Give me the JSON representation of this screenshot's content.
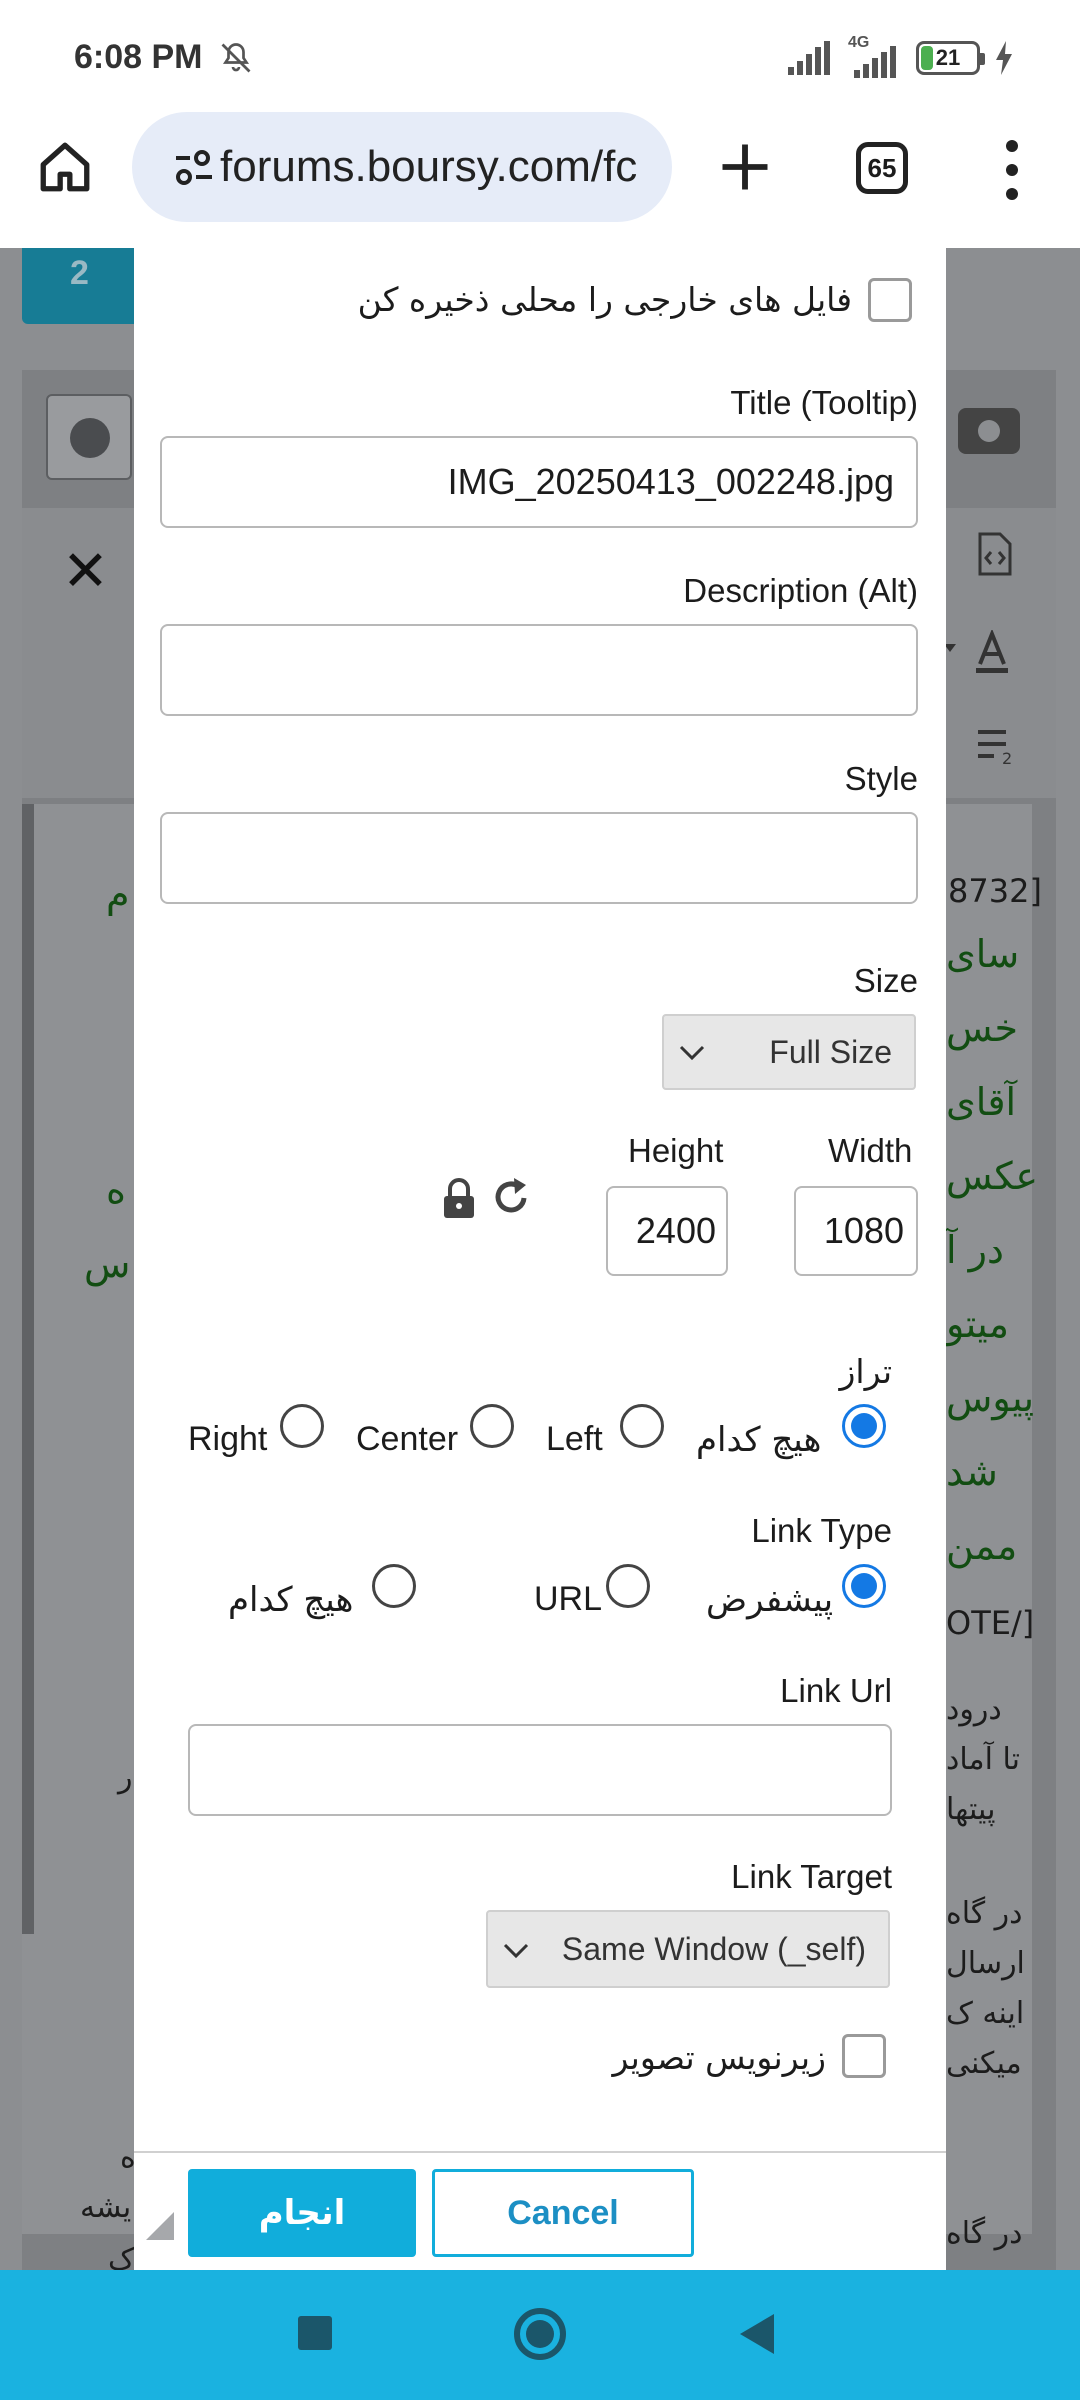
{
  "status_bar": {
    "time": "6:08 PM",
    "network": "4G",
    "battery": "21",
    "battery_level_percent": 21,
    "icons": [
      "bell-off-icon",
      "signal-icon",
      "signal-4g-icon",
      "battery-icon",
      "charging-icon"
    ]
  },
  "browser": {
    "url": "forums.boursy.com/fc",
    "tab_count": "65",
    "icons": [
      "home-icon",
      "site-settings-icon",
      "plus-icon",
      "tabs-icon",
      "more-vert-icon"
    ]
  },
  "background_page": {
    "tab_number": "2",
    "snippets": {
      "left_1": "م",
      "left_2": "ه",
      "left_3": "س",
      "left_4": "ر",
      "left_5": "ه",
      "left_6": "یشه",
      "left_7": "ک",
      "right_1": "8732]",
      "right_2": "سای",
      "right_3": "خس",
      "right_4": "آقای",
      "right_5": "عکس",
      "right_6": "در آ",
      "right_7": "میتو",
      "right_8": "پیوس",
      "right_9": "شد",
      "right_10": "ممن",
      "right_11": "OTE/]",
      "right_12": "درود",
      "right_13": "تا آماد",
      "right_14": "پیتها",
      "right_15": "در گاه",
      "right_16": "ارسال",
      "right_17": "اینه ک",
      "right_18": "میکنی",
      "right_19": "در گاه"
    }
  },
  "dialog": {
    "save_external_label": "فایل های خارجی را محلی ذخیره کن",
    "title_label": "Title (Tooltip)",
    "title_value": "IMG_20250413_002248.jpg",
    "description_label": "Description (Alt)",
    "description_value": "",
    "style_label": "Style",
    "style_value": "",
    "size_label": "Size",
    "size_selected": "Full Size",
    "width_label": "Width",
    "width_value": "1080",
    "height_label": "Height",
    "height_value": "2400",
    "align_label": "تراز",
    "align_options": [
      "هیچ کدام",
      "Left",
      "Center",
      "Right"
    ],
    "align_selected": "هیچ کدام",
    "link_type_label": "Link Type",
    "link_type_options": [
      "پیشفرض",
      "URL",
      "هیچ کدام"
    ],
    "link_type_selected": "پیشفرض",
    "link_url_label": "Link Url",
    "link_url_value": "",
    "link_target_label": "Link Target",
    "link_target_selected": "Same Window (_self)",
    "caption_label": "زیرنویس تصویر",
    "ok_label": "انجام",
    "cancel_label": "Cancel"
  },
  "colors": {
    "primary_button": "#11addb",
    "radio_selected": "#1479e4",
    "nav_bar": "#1ab2e0",
    "url_bar": "#e6ecf8"
  }
}
